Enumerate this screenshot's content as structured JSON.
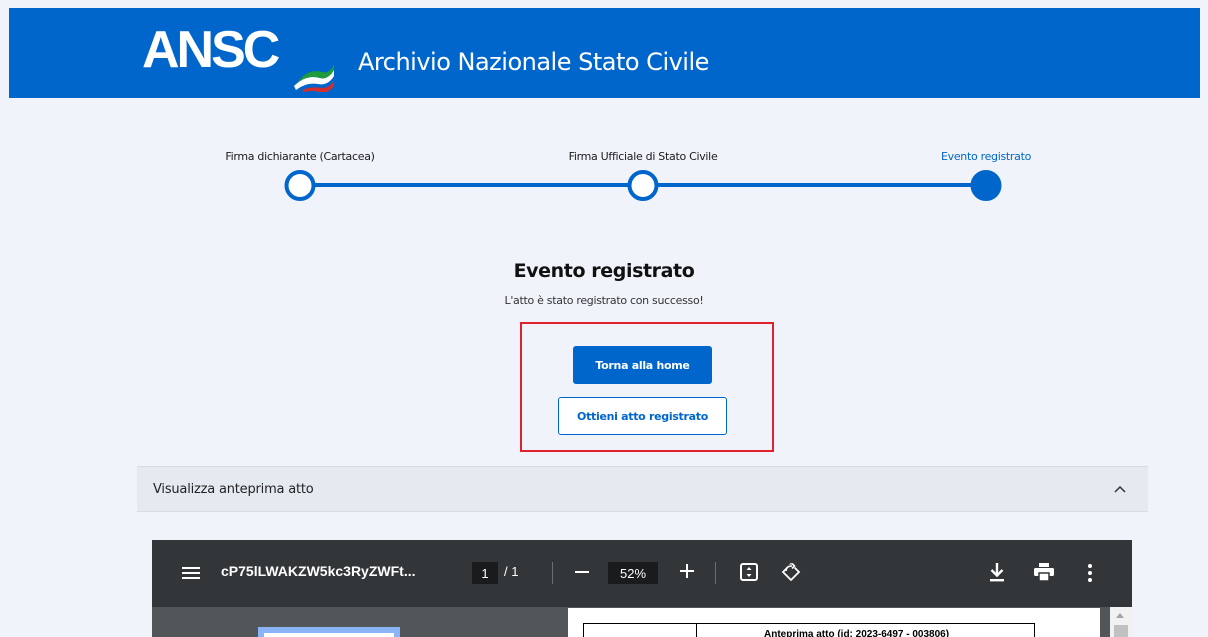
{
  "header": {
    "logo_text": "ANSC",
    "title": "Archivio Nazionale Stato Civile",
    "background": "#0066cc"
  },
  "stepper": {
    "steps": [
      {
        "label": "Firma dichiarante (Cartacea)",
        "state": "completed"
      },
      {
        "label": "Firma Ufficiale di Stato Civile",
        "state": "completed"
      },
      {
        "label": "Evento registrato",
        "state": "current"
      }
    ]
  },
  "result": {
    "title": "Evento registrato",
    "subtitle": "L'atto è stato registrato con successo!",
    "primary_button": "Torna alla home",
    "secondary_button": "Ottieni atto registrato"
  },
  "accordion": {
    "title": "Visualizza anteprima atto",
    "expanded": true
  },
  "pdf_viewer": {
    "filename": "cP75lLWAKZW5kc3RyZWFt...",
    "current_page": "1",
    "total_pages": "/ 1",
    "zoom": "52%",
    "page_heading": "Anteprima atto (id: 2023-6497 - 003806)",
    "icons": [
      "menu-icon",
      "minus-icon",
      "plus-icon",
      "fit-page-icon",
      "rotate-icon",
      "download-icon",
      "print-icon",
      "more-vert-icon"
    ]
  },
  "colors": {
    "accent": "#0066cc",
    "highlight": "#e0202c",
    "page_bg": "#f0f4fa",
    "pdf_toolbar": "#323639"
  }
}
